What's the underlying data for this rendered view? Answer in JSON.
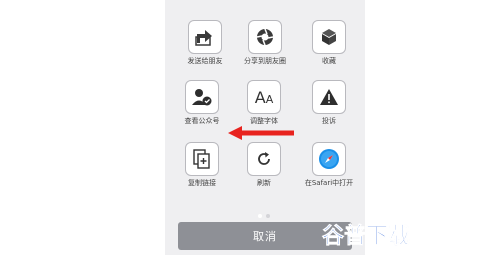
{
  "share_sheet": {
    "row1": [
      {
        "label": "发送给朋友",
        "icon": "share-arrow-icon"
      },
      {
        "label": "分享到朋友圈",
        "icon": "moments-aperture-icon"
      },
      {
        "label": "收藏",
        "icon": "favorite-cube-icon"
      }
    ],
    "row2": [
      {
        "label": "查看公众号",
        "icon": "official-account-icon"
      },
      {
        "label": "调整字体",
        "icon": "font-size-icon"
      },
      {
        "label": "投诉",
        "icon": "warning-icon"
      }
    ],
    "row3": [
      {
        "label": "复制链接",
        "icon": "copy-link-icon"
      },
      {
        "label": "刷新",
        "icon": "refresh-icon"
      },
      {
        "label": "在Safari中打开",
        "icon": "safari-compass-icon"
      }
    ],
    "page_indicator": {
      "pages": 2,
      "current": 1
    },
    "cancel_label": "取消"
  },
  "annotation": {
    "arrow_color": "#e8231f"
  },
  "watermark": {
    "text": "谷普下载",
    "color": "#2a63d6"
  }
}
